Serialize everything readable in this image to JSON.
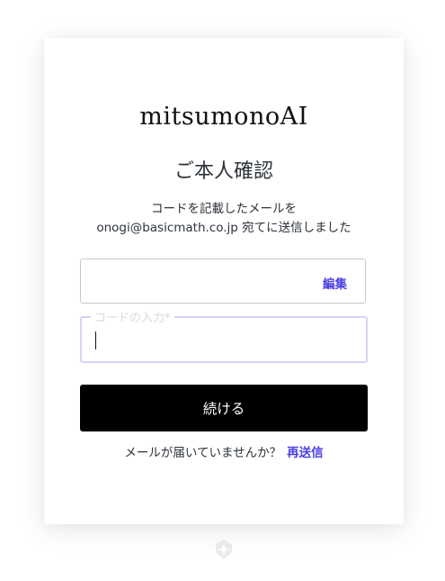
{
  "brand": {
    "logo_text": "mitsumonoAI"
  },
  "verify": {
    "title": "ご本人確認",
    "desc_line1": "コードを記載したメールを",
    "desc_line2": "onogi@basicmath.co.jp 宛てに送信しました"
  },
  "email_box": {
    "edit_label": "編集"
  },
  "code_field": {
    "label": "コードの入力*",
    "value": ""
  },
  "actions": {
    "continue_label": "続ける",
    "resend_prompt": "メールが届いていませんか？",
    "resend_label": "再送信"
  },
  "colors": {
    "accent": "#4a3fe0",
    "button_bg": "#000000"
  },
  "icons": {
    "footer": "shield-logo-icon"
  }
}
